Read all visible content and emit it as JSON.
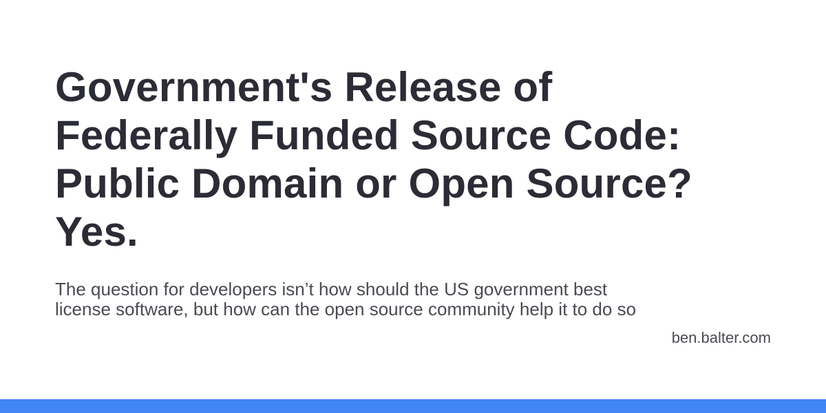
{
  "card": {
    "title_lines": [
      "Government's Release of",
      "Federally Funded Source Code:",
      "Public Domain or Open Source?",
      "Yes."
    ],
    "description": "The question for developers isn’t how should the US government best license software, but how can the open source community help it to do so",
    "site": "ben.balter.com"
  },
  "colors": {
    "background": "#ffffff",
    "title_text": "#2b2c35",
    "body_text": "#4a4b52",
    "accent_bar": "#4285f4"
  }
}
